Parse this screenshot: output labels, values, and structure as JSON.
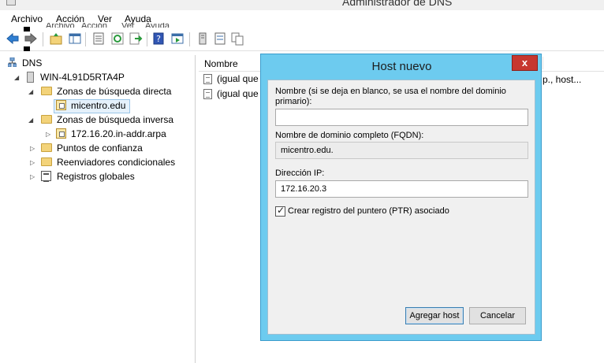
{
  "window": {
    "title": "Administrador de DNS"
  },
  "menu": {
    "items": [
      "Archivo",
      "Acción",
      "Ver",
      "Ayuda"
    ],
    "ghost_items": [
      "Archivo",
      "Acción",
      "Ver",
      "Ayuda"
    ]
  },
  "tree": {
    "root": "DNS",
    "server": "WIN-4L91D5RTA4P",
    "forward_zones": "Zonas de búsqueda directa",
    "forward_zone_child": "micentro.edu",
    "reverse_zones": "Zonas de búsqueda inversa",
    "reverse_zone_child": "172.16.20.in-addr.arpa",
    "trust_points": "Puntos de confianza",
    "conditional_forwarders": "Reenviadores condicionales",
    "global_logs": "Registros globales"
  },
  "list": {
    "column_name": "Nombre",
    "rows": [
      "(igual que",
      "(igual que"
    ],
    "row_right_text": "p., host..."
  },
  "dialog": {
    "title": "Host nuevo",
    "close_label": "x",
    "name_label": "Nombre (si se deja en blanco, se usa el nombre del dominio primario):",
    "name_value": "",
    "fqdn_label": "Nombre de dominio completo (FQDN):",
    "fqdn_value": "micentro.edu.",
    "ip_label": "Dirección IP:",
    "ip_value": "172.16.20.3",
    "ptr_checkbox_label": "Crear registro del puntero (PTR) asociado",
    "ptr_checked": true,
    "add_button": "Agregar host",
    "cancel_button": "Cancelar"
  },
  "colors": {
    "dialog_frame": "#6dcbef",
    "close_button": "#c7372f",
    "selection": "#e5f1fb"
  },
  "icons": {
    "toolbar": [
      "back-arrow-icon",
      "forward-arrow-icon",
      "folder-up-icon",
      "console-tree-icon",
      "properties-icon",
      "refresh-icon",
      "export-icon",
      "help-icon",
      "show-action-pane-icon",
      "server-icon",
      "list-icon",
      "copy-icon"
    ]
  }
}
